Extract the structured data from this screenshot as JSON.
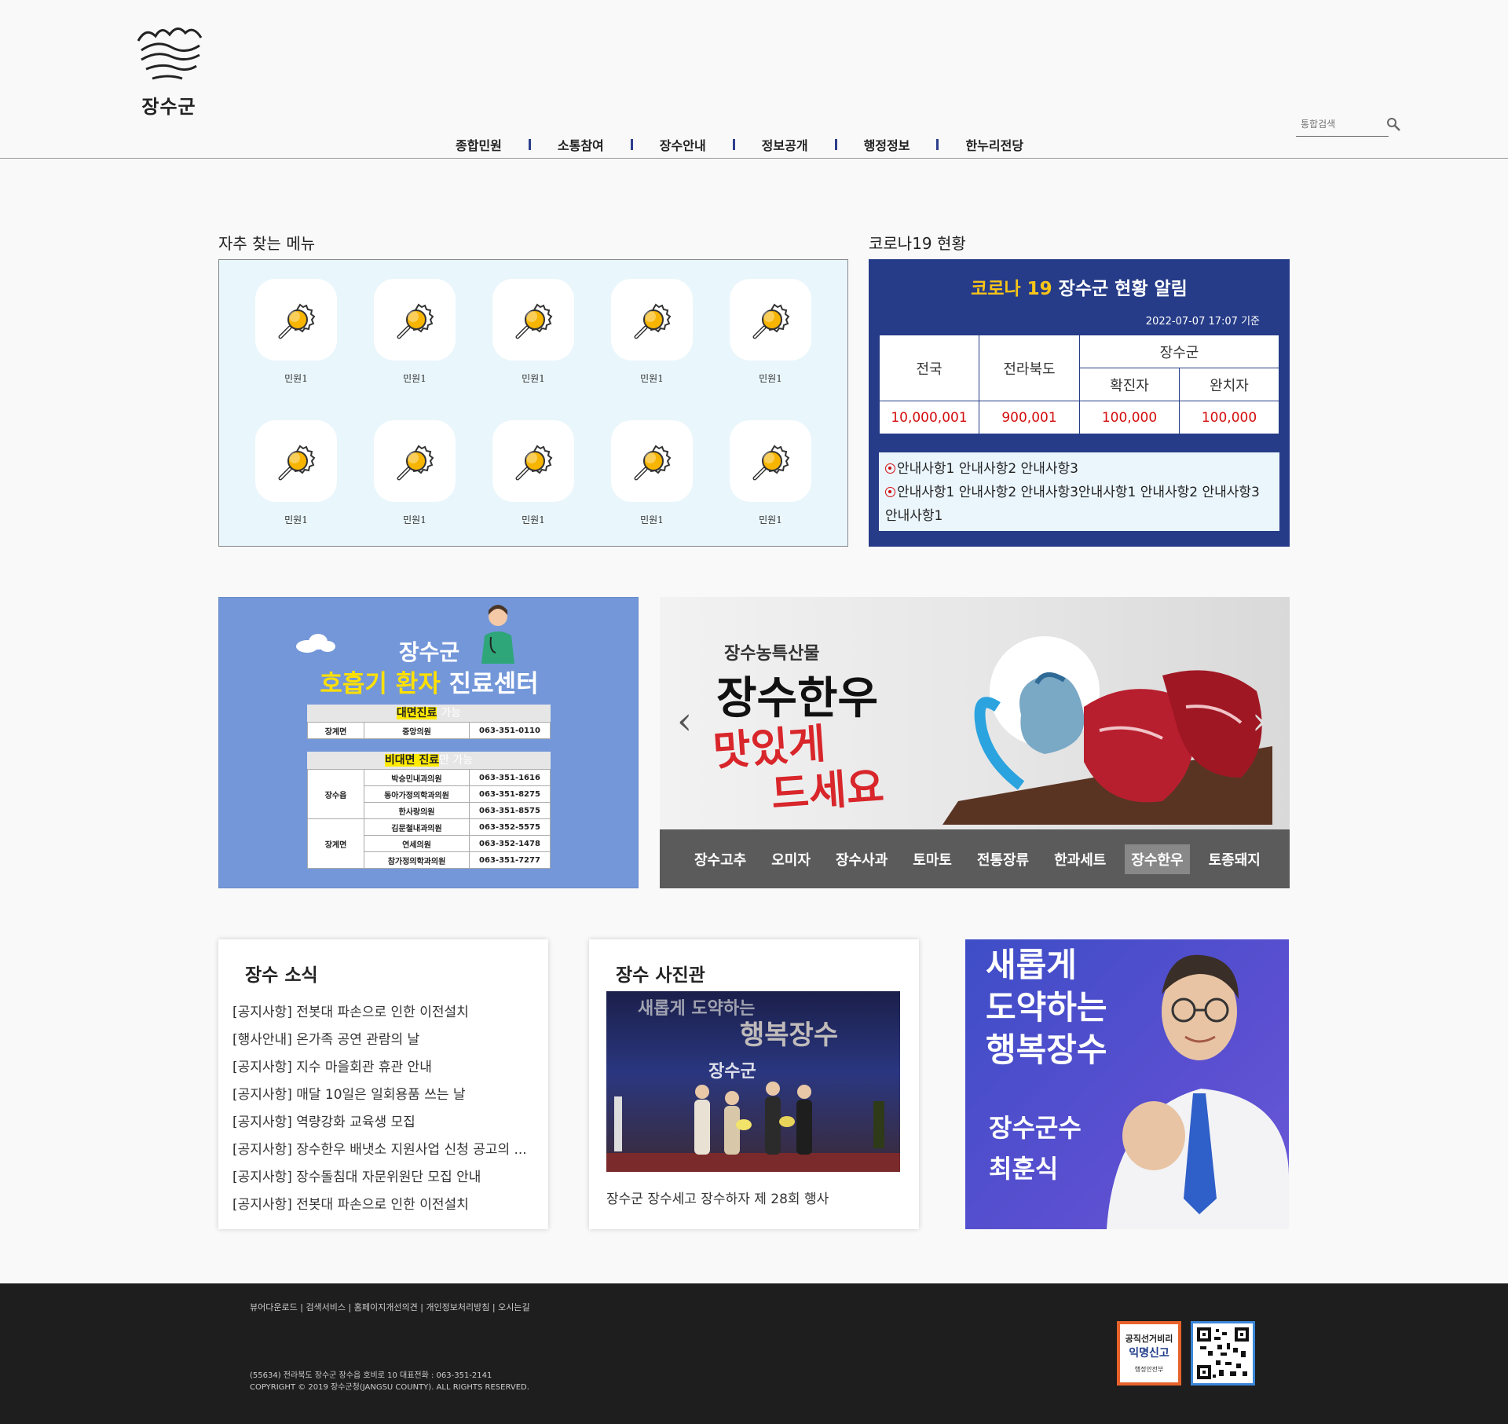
{
  "header": {
    "logo_text": "장수군",
    "nav": [
      "종합민원",
      "소통참여",
      "장수안내",
      "정보공개",
      "행정정보",
      "한누리전당"
    ],
    "search_placeholder": "통합검색"
  },
  "quick_menu": {
    "title": "자추 찾는 메뉴",
    "items": [
      "민원1",
      "민원1",
      "민원1",
      "민원1",
      "민원1",
      "민원1",
      "민원1",
      "민원1",
      "민원1",
      "민원1"
    ]
  },
  "covid": {
    "section_title": "코로나19 현황",
    "title_highlight": "코로나 19",
    "title_rest": " 장수군 현황 알림",
    "date": "2022-07-07 17:07 기준",
    "col_national": "전국",
    "col_province": "전라북도",
    "col_county": "장수군",
    "col_confirmed": "확진자",
    "col_recovered": "완치자",
    "val_national": "10,000,001",
    "val_province": "900,001",
    "val_confirmed": "100,000",
    "val_recovered": "100,000",
    "notices": [
      "안내사항1 안내사항2 안내사항3",
      "안내사항1 안내사항2 안내사항3안내사항1 안내사항2 안내사항3 안내사항1"
    ],
    "colors": {
      "panel": "#263c88",
      "highlight": "#f7c418",
      "value": "#d40d0d"
    }
  },
  "banner_left": {
    "title1": "장수군",
    "title2_highlight": "호흡기 환자",
    "title2_rest": " 진료센터",
    "face_head_mark": "대면진료",
    "face_head_light": "가능",
    "face_rows": [
      [
        "장계면",
        "중앙의원",
        "063-351-0110"
      ]
    ],
    "nonface_head_mark": "비대면 진료",
    "nonface_head_light": "만 가능",
    "nonface_group1": "장수읍",
    "nonface_group2": "장계면",
    "nonface_rows": [
      [
        "박승민내과의원",
        "063-351-1616"
      ],
      [
        "동아가정의학과의원",
        "063-351-8275"
      ],
      [
        "한사랑의원",
        "063-351-8575"
      ],
      [
        "김문철내과의원",
        "063-352-5575"
      ],
      [
        "연세의원",
        "063-352-1478"
      ],
      [
        "참가정의학과의원",
        "063-351-7277"
      ]
    ]
  },
  "banner_right": {
    "subtitle": "장수농특산물",
    "main": "장수한우",
    "script_line1": "맛있게",
    "script_line2": "드세요",
    "prev_arrow": "‹",
    "next_arrow": "›",
    "tabs": [
      "장수고추",
      "오미자",
      "장수사과",
      "토마토",
      "전통장류",
      "한과세트",
      "장수한우",
      "토종돼지"
    ],
    "active_tab": "장수한우"
  },
  "news": {
    "title": "장수 소식",
    "items": [
      "[공지사항] 전봇대 파손으로 인한 이전설치",
      "[행사안내] 온가족 공연 관람의 날",
      "[공지사항] 지수 마을회관 휴관 안내",
      "[공지사항] 매달 10일은 일회용품 쓰는 날",
      "[공지사항] 역량강화 교육생 모집",
      "[공지사항] 장수한우 배냇소 지원사업 신청 공고의 ...",
      "[공지사항] 장수돌침대 자문위원단 모집 안내",
      "[공지사항] 전봇대 파손으로 인한 이전설치"
    ]
  },
  "photo": {
    "title": "장수 사진관",
    "image_text_top": "새롭게 도약하는",
    "image_text_mid": "행복장수",
    "image_text_logo": "장수군",
    "caption": "장수군 장수세고 장수하자 제 28회 행사"
  },
  "mayor": {
    "slogan_lines": [
      "새롭게",
      "도약하는",
      "행복장수"
    ],
    "sig_line1": "장수군수",
    "sig_line2": "최훈식"
  },
  "footer": {
    "links": [
      "뷰어다운로드",
      "검색서비스",
      "홈페이지개선의견",
      "개인정보처리방침",
      "오시는길"
    ],
    "address": "(55634) 전라북도 장수군 장수읍 호비로 10 대표전화 : 063-351-2141",
    "copyright": "COPYRIGHT © 2019 장수군청(JANGSU COUNTY). ALL RIGHTS RESERVED.",
    "badge_line1": "공직선거비리",
    "badge_line2": "익명신고",
    "badge_line3": "행정안전부"
  }
}
